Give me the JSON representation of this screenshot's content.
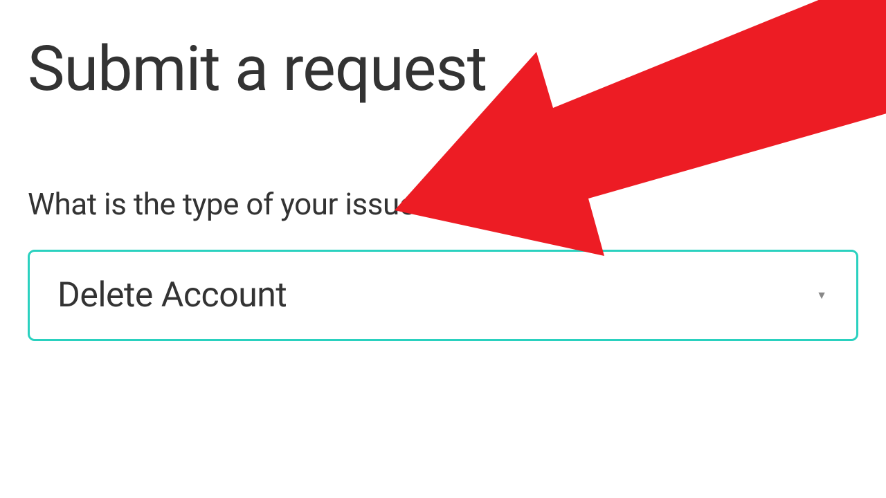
{
  "page": {
    "title": "Submit a request"
  },
  "form": {
    "issue_type": {
      "label": "What is the type of your issue?",
      "selected": "Delete Account"
    }
  },
  "annotation": {
    "arrow_color": "#ed1c24"
  }
}
